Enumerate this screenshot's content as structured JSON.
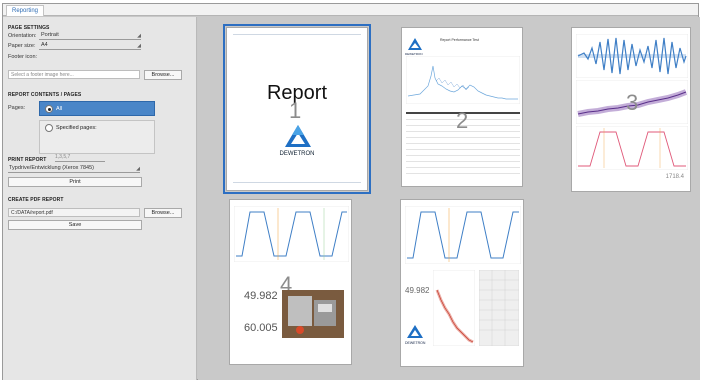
{
  "tab": {
    "label": "Reporting"
  },
  "page_settings": {
    "heading": "PAGE SETTINGS",
    "orientation_label": "Orientation:",
    "orientation_value": "Portrait",
    "paper_label": "Paper size:",
    "paper_value": "A4",
    "footer_label": "Footer icon:",
    "footer_placeholder": "Select a footer image here...",
    "browse_label": "Browse..."
  },
  "report_contents": {
    "heading": "REPORT CONTENTS / PAGES",
    "pages_label": "Pages:",
    "all_label": "All",
    "specified_label": "Specified pages:",
    "specified_placeholder": "1,3,5,7"
  },
  "print_report": {
    "heading": "PRINT REPORT",
    "printer_value": "Typdrive/Entwicklung (Xerox 7845)",
    "print_label": "Print"
  },
  "create_pdf": {
    "heading": "CREATE PDF REPORT",
    "path_value": "C:/DATA/report.pdf",
    "browse_label": "Browse...",
    "save_label": "Save"
  },
  "pages": {
    "p1": {
      "title": "Report",
      "number": "1",
      "logo_text": "DEWETRON"
    },
    "p2": {
      "number": "2",
      "heading": "Report Performance Test",
      "logo_text": "DEWETRON"
    },
    "p3": {
      "number": "3",
      "value": "1718.4"
    },
    "p4": {
      "number": "4",
      "value_a": "49.982",
      "value_b": "60.005"
    },
    "p5": {
      "number": "5",
      "value_a": "49.982",
      "logo_text": "DEWETRON"
    }
  },
  "colors": {
    "accent": "#2d6fc2",
    "plot_blue": "#3f7fc6",
    "plot_purple": "#7a4aa8",
    "plot_pink": "#e05a7a",
    "plot_red": "#d24a3a"
  }
}
